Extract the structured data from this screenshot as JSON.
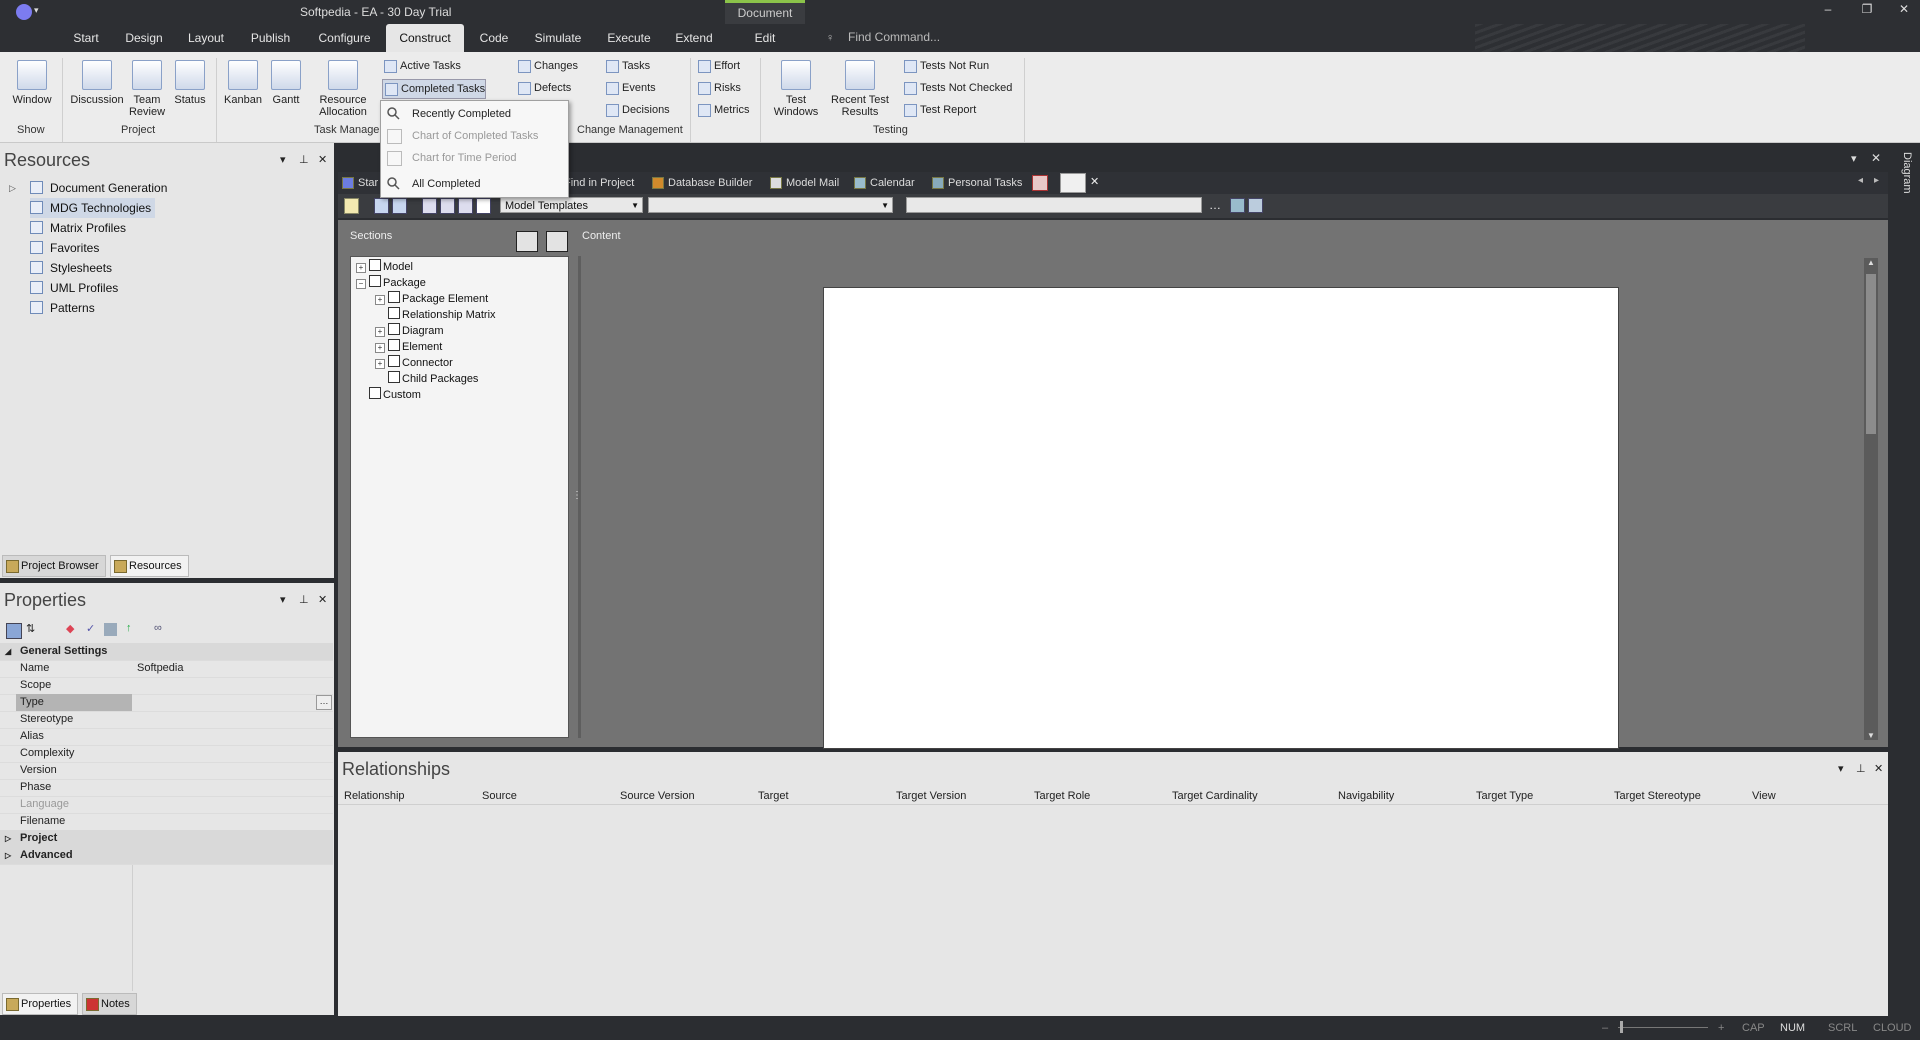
{
  "window": {
    "title": "Softpedia - EA - 30 Day Trial",
    "context_tab": "Document",
    "minimize": "–",
    "restore": "❐",
    "close": "✕"
  },
  "ribbon_tabs": [
    "Start",
    "Design",
    "Layout",
    "Publish",
    "Configure",
    "Construct",
    "Code",
    "Simulate",
    "Execute",
    "Extend",
    "Edit"
  ],
  "active_tab": "Construct",
  "find_command": {
    "placeholder": "Find Command..."
  },
  "ribbon": {
    "show_group": {
      "label": "Show",
      "window_btn": "Window"
    },
    "project_group": {
      "label": "Project",
      "discussion": "Discussion",
      "team_review": "Team Review",
      "status": "Status"
    },
    "kanban": "Kanban",
    "gantt": "Gantt",
    "resource_allocation": "Resource Allocation",
    "task_group": {
      "label": "Task Manage",
      "active_tasks": "Active Tasks",
      "completed_tasks": "Completed Tasks"
    },
    "change_group": {
      "label": "Change Management",
      "changes": "Changes",
      "defects": "Defects",
      "tasks": "Tasks",
      "events": "Events",
      "decisions": "Decisions",
      "effort": "Effort",
      "risks": "Risks",
      "metrics": "Metrics"
    },
    "testing_group": {
      "label": "Testing",
      "test_windows": "Test Windows",
      "recent_test_results": "Recent Test Results",
      "tests_not_run": "Tests Not Run",
      "tests_not_checked": "Tests Not Checked",
      "test_report": "Test Report"
    }
  },
  "dropdown": {
    "items": [
      {
        "label": "Recently Completed",
        "enabled": true
      },
      {
        "label": "Chart of Completed Tasks",
        "enabled": false
      },
      {
        "label": "Chart for Time Period",
        "enabled": false
      },
      {
        "label": "All Completed",
        "enabled": true
      }
    ]
  },
  "resources": {
    "title": "Resources",
    "items": [
      "Document Generation",
      "MDG Technologies",
      "Matrix Profiles",
      "Favorites",
      "Stylesheets",
      "UML Profiles",
      "Patterns"
    ],
    "selected": "MDG Technologies",
    "bottom_tabs": [
      "Project Browser",
      "Resources"
    ]
  },
  "properties": {
    "title": "Properties",
    "groups": [
      "General Settings",
      "Project",
      "Advanced"
    ],
    "rows": [
      {
        "key": "Name",
        "value": "Softpedia"
      },
      {
        "key": "Scope",
        "value": ""
      },
      {
        "key": "Type",
        "value": ""
      },
      {
        "key": "Stereotype",
        "value": ""
      },
      {
        "key": "Alias",
        "value": ""
      },
      {
        "key": "Complexity",
        "value": ""
      },
      {
        "key": "Version",
        "value": ""
      },
      {
        "key": "Phase",
        "value": ""
      },
      {
        "key": "Language",
        "value": ""
      },
      {
        "key": "Filename",
        "value": ""
      }
    ],
    "bottom_tabs": [
      "Properties",
      "Notes"
    ]
  },
  "doc_tabs": [
    "Star",
    "Find in Project",
    "Database Builder",
    "Model Mail",
    "Calendar",
    "Personal Tasks"
  ],
  "doc_toolbar": {
    "template_select": "Model Templates"
  },
  "doc_panel": {
    "sections_label": "Sections",
    "content_label": "Content",
    "sections": [
      {
        "label": "Model",
        "level": 0,
        "expander": "+"
      },
      {
        "label": "Package",
        "level": 0,
        "expander": "−"
      },
      {
        "label": "Package Element",
        "level": 1,
        "expander": "+"
      },
      {
        "label": "Relationship Matrix",
        "level": 1,
        "expander": ""
      },
      {
        "label": "Diagram",
        "level": 1,
        "expander": "+"
      },
      {
        "label": "Element",
        "level": 1,
        "expander": "+"
      },
      {
        "label": "Connector",
        "level": 1,
        "expander": "+"
      },
      {
        "label": "Child Packages",
        "level": 1,
        "expander": ""
      },
      {
        "label": "Custom",
        "level": 0,
        "expander": ""
      }
    ]
  },
  "relationships": {
    "title": "Relationships",
    "columns": [
      "Relationship",
      "Source",
      "Source Version",
      "Target",
      "Target Version",
      "Target Role",
      "Target Cardinality",
      "Navigability",
      "Target Type",
      "Target Stereotype",
      "View"
    ]
  },
  "right_strip": {
    "label": "Diagram"
  },
  "status_bar": {
    "caps": "CAP",
    "num": "NUM",
    "scrl": "SCRL",
    "cloud": "CLOUD"
  }
}
